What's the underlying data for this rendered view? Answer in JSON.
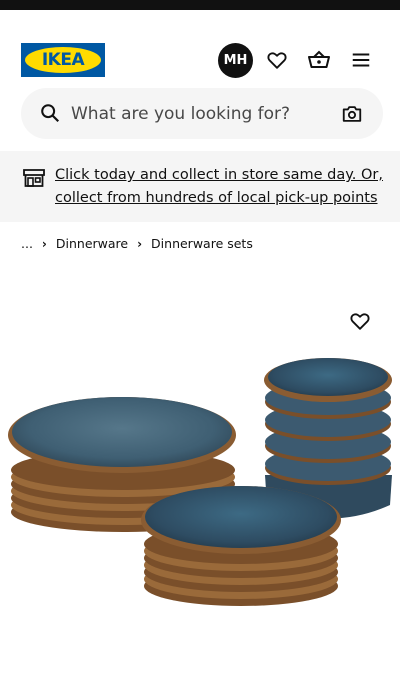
{
  "header": {
    "logo_text": "IKEA",
    "avatar_initials": "MH",
    "icons": [
      "heart-icon",
      "basket-icon",
      "menu-icon"
    ]
  },
  "search": {
    "placeholder": "What are you looking for?"
  },
  "banner": {
    "text": "Click today and collect in store same day. Or, collect from hundreds of local pick-up points"
  },
  "breadcrumb": {
    "ellipsis": "...",
    "items": [
      "Dinnerware",
      "Dinnerware sets"
    ]
  },
  "colors": {
    "brand_blue": "#0058a3",
    "brand_yellow": "#ffdb00",
    "search_bg": "#f5f5f5",
    "plate_glaze": "#3f5f73",
    "plate_rim": "#9a6a3a"
  }
}
